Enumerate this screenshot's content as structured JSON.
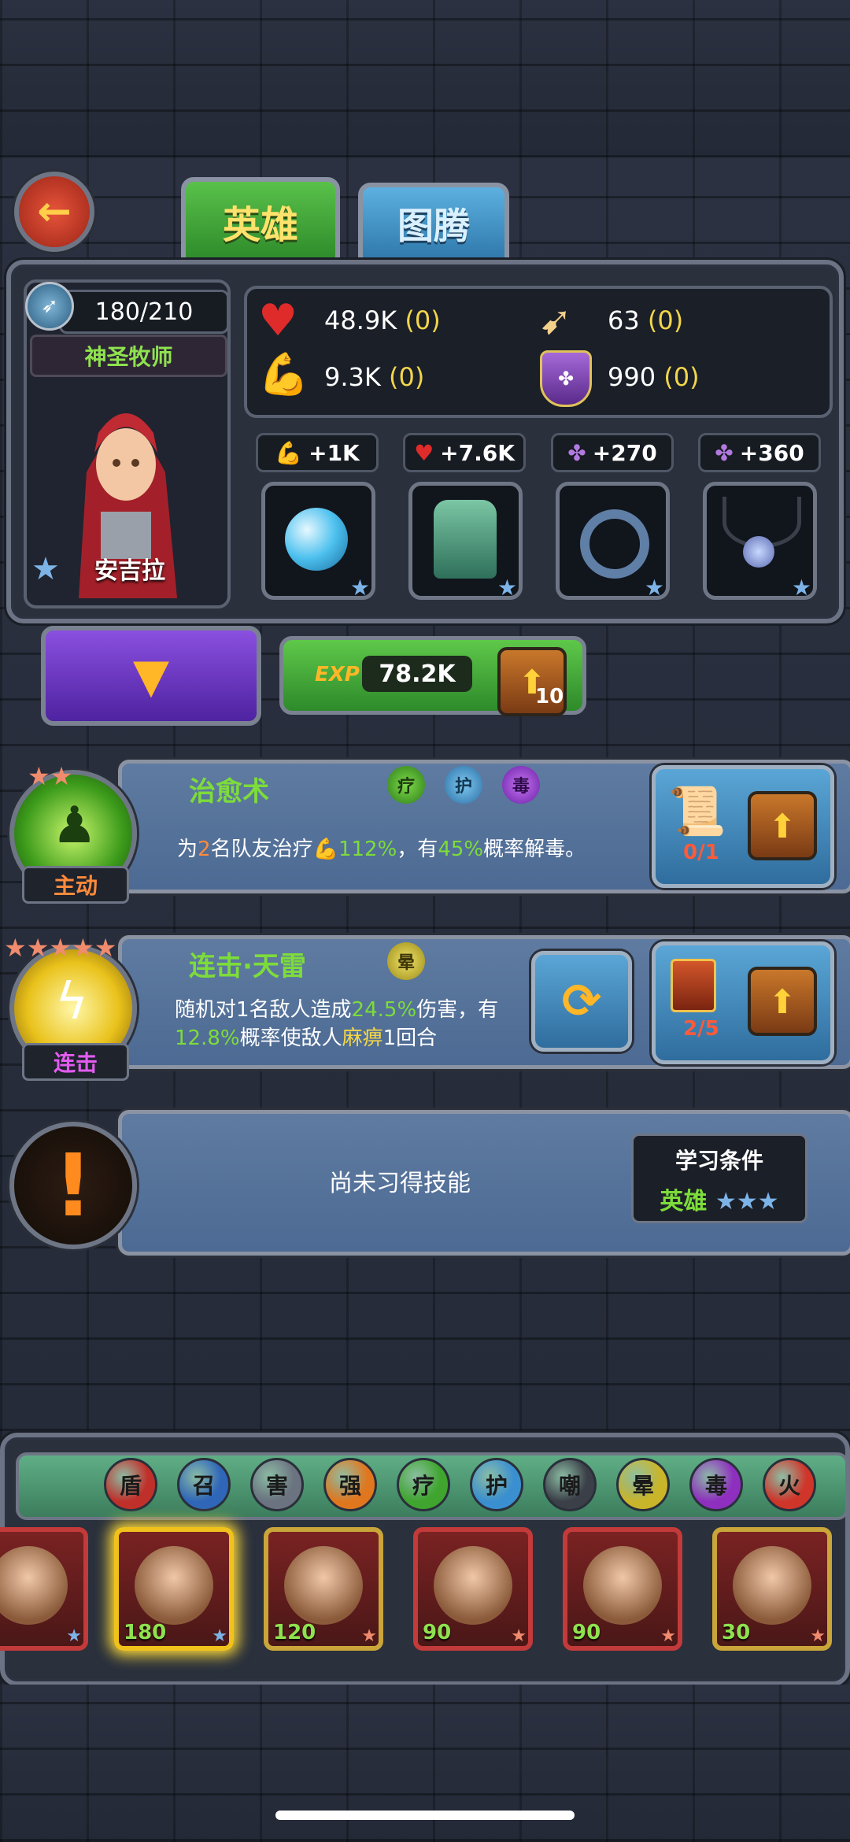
{
  "tabs": {
    "hero": "英雄",
    "totem": "图腾"
  },
  "hero": {
    "level": "180/210",
    "class_name": "神圣牧师",
    "name": "安吉拉"
  },
  "stats": {
    "hp": "48.9K",
    "hp_bonus": "(0)",
    "attack": "9.3K",
    "attack_bonus": "(0)",
    "speed": "63",
    "speed_bonus": "(0)",
    "defense": "990",
    "defense_bonus": "(0)"
  },
  "equip_bonuses": [
    "+1K",
    "+7.6K",
    "+270",
    "+360"
  ],
  "exp": {
    "label": "EXP",
    "value": "78.2K",
    "upgrade_count": "10"
  },
  "skills": {
    "active": {
      "title": "治愈术",
      "type": "主动",
      "tags": [
        "疗",
        "护",
        "毒"
      ],
      "desc_1": "为",
      "desc_2": "2",
      "desc_3": "名队友治疗",
      "desc_4": "112%",
      "desc_5": "，有",
      "desc_6": "45%",
      "desc_7": "概率解毒。",
      "scroll_count": "0/1"
    },
    "combo": {
      "title": "连击·天雷",
      "type": "连击",
      "tags": [
        "晕"
      ],
      "line1_a": "随机对1名敌人造成",
      "line1_b": "24.5%",
      "line1_c": "伤害，有",
      "line2_a": "12.8%",
      "line2_b": "概率使敌人",
      "line2_c": "麻痹",
      "line2_d": "1回合",
      "book_count": "2/5"
    },
    "locked": {
      "text": "尚未习得技能",
      "cond_title": "学习条件",
      "cond_value": "英雄"
    }
  },
  "filters": [
    "盾",
    "召",
    "害",
    "强",
    "疗",
    "护",
    "嘲",
    "晕",
    "毒",
    "火"
  ],
  "filter_colors": [
    "#c0302a",
    "#2f66b8",
    "#6b7280",
    "#e0771f",
    "#3fa52e",
    "#3a8fd0",
    "#3b3f48",
    "#c9b52a",
    "#8e2fbf",
    "#d0352a"
  ],
  "roster": [
    {
      "level": ""
    },
    {
      "level": "180"
    },
    {
      "level": "120"
    },
    {
      "level": "90"
    },
    {
      "level": "90"
    },
    {
      "level": "30"
    }
  ]
}
